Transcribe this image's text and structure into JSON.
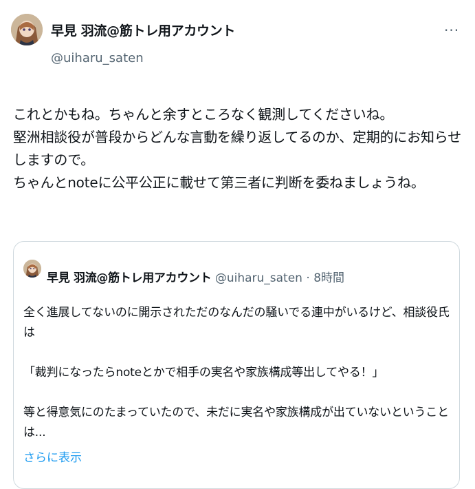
{
  "tweet": {
    "display_name": "早見 羽流@筋トレ用アカウント",
    "handle": "@uiharu_saten",
    "more_label": "···",
    "text": "これとかもね。ちゃんと余すところなく観測してくださいね。\n堅洲相談役が普段からどんな言動を繰り返してるのか、定期的にお知らせしますので。\nちゃんとnoteに公平公正に載せて第三者に判断を委ねましょうね。"
  },
  "quoted": {
    "display_name": "早見 羽流@筋トレ用アカウント",
    "handle": "@uiharu_saten",
    "separator": " · ",
    "time": "8時間",
    "text": "全く進展してないのに開示されただのなんだの騒いでる連中がいるけど、相談役氏は\n\n「裁判になったらnoteとかで相手の実名や家族構成等出してやる！」\n\n等と得意気にのたまっていたので、未だに実名や家族構成が出ていないということは...",
    "show_more": "さらに表示"
  },
  "icons": {
    "avatar": "avatar-image",
    "more": "more-dots-icon"
  }
}
